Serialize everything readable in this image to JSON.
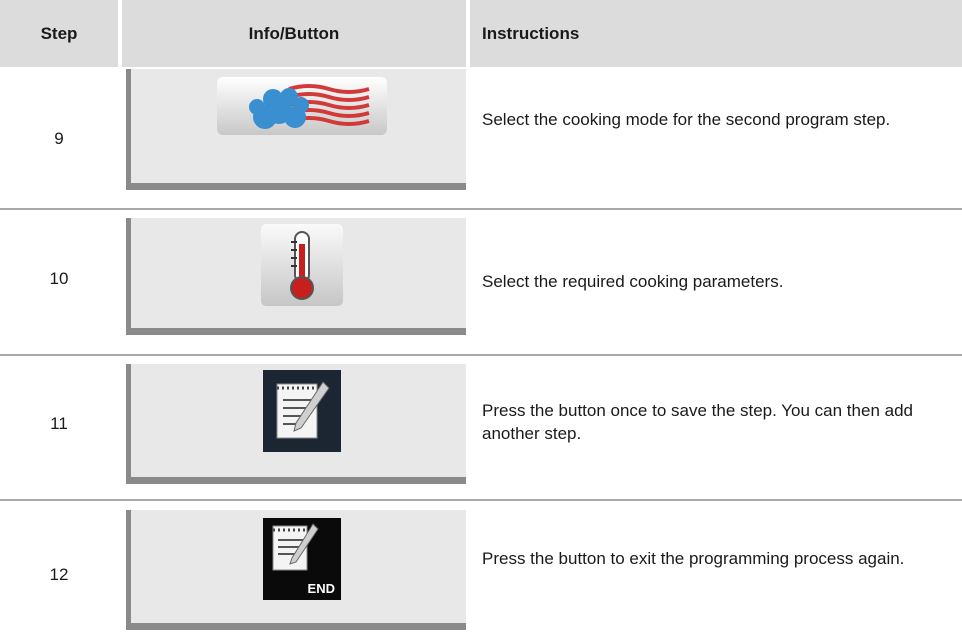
{
  "header": {
    "step": "Step",
    "info_button": "Info/Button",
    "instructions": "Instructions"
  },
  "rows": [
    {
      "step": "9",
      "icon": "steam-convection-icon",
      "instruction": "Select the cooking mode for the second program step."
    },
    {
      "step": "10",
      "icon": "thermometer-icon",
      "instruction": "Select the required cooking parameters."
    },
    {
      "step": "11",
      "icon": "notepad-pencil-icon",
      "instruction": "Press the button once to save the step. You can then add another step."
    },
    {
      "step": "12",
      "icon": "notepad-end-icon",
      "instruction": "Press the button to exit the programming process again.",
      "button_label": "END"
    }
  ],
  "colors": {
    "header_bg": "#dcdcdc",
    "panel_bg": "#e8e8e8",
    "panel_border": "#8a8a8a",
    "steam_blue": "#3a8fd0",
    "steam_red": "#d23a3a",
    "thermo_red": "#c81e1e",
    "dark_button": "#1c2632"
  }
}
